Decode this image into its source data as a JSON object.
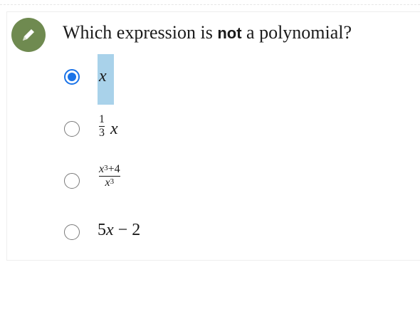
{
  "question": {
    "prefix": "Which expression is",
    "emphasis": "not",
    "suffix": "a polynomial?"
  },
  "options": [
    {
      "id": "a",
      "selected": true,
      "var": "x"
    },
    {
      "id": "b",
      "selected": false,
      "coef_num": "1",
      "coef_den": "3",
      "var": "x"
    },
    {
      "id": "c",
      "selected": false,
      "num_var": "x",
      "num_exp": "3",
      "num_rest": "+4",
      "den_var": "x",
      "den_exp": "3"
    },
    {
      "id": "d",
      "selected": false,
      "lead": "5",
      "var": "x",
      "op": "−",
      "const": "2"
    }
  ],
  "colors": {
    "accent": "#1a73e8",
    "badge": "#6f8a50",
    "highlight": "#a9d2ea"
  },
  "icons": {
    "badge": "pencil-icon"
  }
}
